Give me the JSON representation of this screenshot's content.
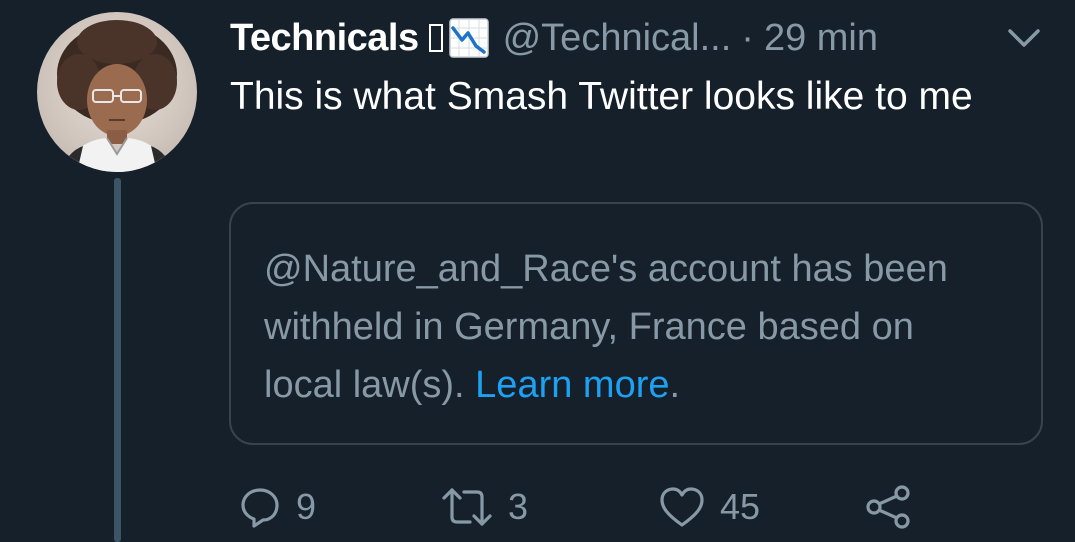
{
  "tweet": {
    "display_name": "Technicals",
    "handle": "@Technical...",
    "separator": "·",
    "timestamp": "29 min",
    "text": "This is what Smash Twitter looks like to me",
    "quote": {
      "message": "@Nature_and_Race's account has been withheld in Germany, France based on local law(s).",
      "link_text": "Learn more",
      "link_suffix": "."
    },
    "actions": {
      "replies": "9",
      "retweets": "3",
      "likes": "45"
    }
  },
  "icons": {
    "caret": "chevron-down-icon",
    "reply": "reply-icon",
    "retweet": "retweet-icon",
    "like": "heart-icon",
    "share": "share-icon",
    "name_emoji": "chart-decreasing-icon"
  },
  "colors": {
    "background": "#15202b",
    "secondary_text": "#8899a6",
    "link": "#1da1f2",
    "border": "#38444d",
    "thread_line": "#3d5466"
  }
}
